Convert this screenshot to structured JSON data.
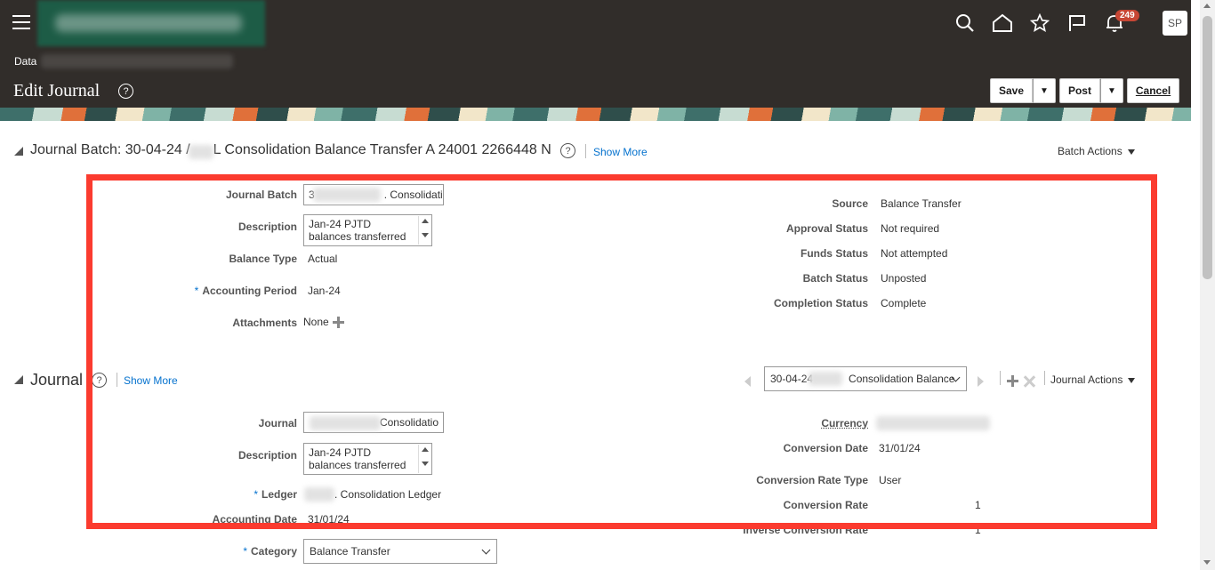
{
  "header": {
    "data_label": "Data",
    "page_title": "Edit Journal",
    "help_glyph": "?",
    "notification_count": "249",
    "avatar_initials": "SP",
    "save_label": "Save",
    "post_label": "Post",
    "cancel_label": "Cancel",
    "caret_glyph": "▼"
  },
  "batch_section": {
    "title_prefix": "Journal Batch: 30-04-24 /",
    "title_suffix": "L Consolidation Balance Transfer A 24001 2266448 N",
    "show_more": "Show More",
    "actions": "Batch Actions",
    "labels": {
      "journal_batch": "Journal Batch",
      "description": "Description",
      "balance_type": "Balance Type",
      "accounting_period": "Accounting Period",
      "attachments": "Attachments",
      "source": "Source",
      "approval_status": "Approval Status",
      "funds_status": "Funds Status",
      "batch_status": "Batch Status",
      "completion_status": "Completion Status"
    },
    "values": {
      "journal_batch_start": "3",
      "journal_batch_end": ". Consolidati",
      "description_line1": "Jan-24  PJTD",
      "description_line2": "balances transferred",
      "balance_type": "Actual",
      "accounting_period": "Jan-24",
      "attachments": "None",
      "source": "Balance Transfer",
      "approval_status": "Not required",
      "funds_status": "Not attempted",
      "batch_status": "Unposted",
      "completion_status": "Complete"
    }
  },
  "journal_section": {
    "title": "Journal",
    "show_more": "Show More",
    "actions": "Journal Actions",
    "selector_start": "30-04-24",
    "selector_end": "Consolidation Balance",
    "labels": {
      "journal": "Journal",
      "description": "Description",
      "ledger": "Ledger",
      "accounting_date": "Accounting Date",
      "category": "Category",
      "currency": "Currency",
      "conversion_date": "Conversion Date",
      "conversion_rate_type": "Conversion Rate Type",
      "conversion_rate": "Conversion Rate",
      "inverse_conversion_rate": "Inverse Conversion Rate"
    },
    "values": {
      "journal_end": "Consolidatio",
      "description_line1": "Jan-24  PJTD",
      "description_line2": "balances transferred",
      "ledger": ". Consolidation Ledger",
      "accounting_date": "31/01/24",
      "category": "Balance Transfer",
      "conversion_date": "31/01/24",
      "conversion_rate_type": "User",
      "conversion_rate": "1",
      "inverse_conversion_rate": "1"
    }
  },
  "colors": {
    "header_bg": "#312d2a",
    "link": "#0572ce",
    "highlight_box": "#fb3b2f",
    "badge": "#c74634"
  }
}
